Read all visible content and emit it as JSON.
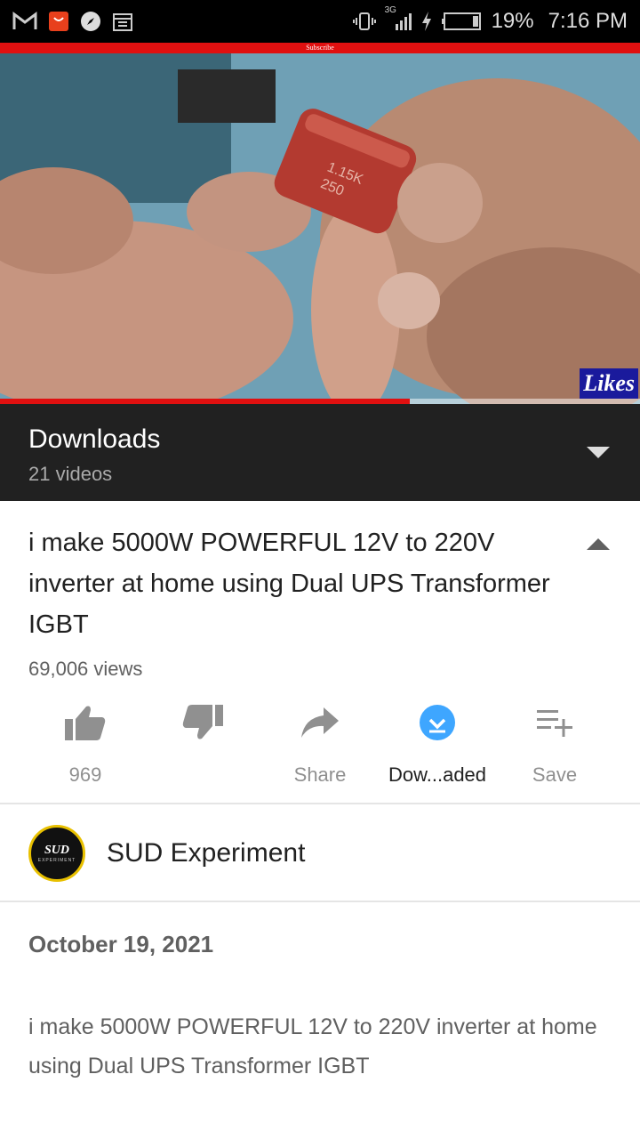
{
  "status_bar": {
    "network": "3G",
    "battery_percent": "19%",
    "time": "7:16 PM",
    "left_icons": [
      "gmail-icon",
      "aliexpress-icon",
      "compass-icon",
      "calendar-icon"
    ]
  },
  "video": {
    "overlay_banner": "Subscribe",
    "likes_badge": "Likes",
    "progress_fraction": 0.64
  },
  "playlist": {
    "title": "Downloads",
    "count": "21 videos"
  },
  "video_info": {
    "title": "i make 5000W POWERFUL 12V to 220V inverter at home using Dual UPS Transformer IGBT",
    "views": "69,006 views"
  },
  "actions": {
    "like_count": "969",
    "dislike_label": "",
    "share_label": "Share",
    "download_label": "Dow...aded",
    "save_label": "Save"
  },
  "channel": {
    "name": "SUD Experiment",
    "avatar_text": "SUD",
    "avatar_subtext": "EXPERIMENT"
  },
  "description": {
    "date": "October 19, 2021",
    "text": "i make 5000W POWERFUL 12V to 220V inverter at home using Dual UPS Transformer IGBT"
  },
  "colors": {
    "accent_red": "#e01010",
    "download_blue": "#3ea6ff",
    "playlist_bg": "#212121"
  }
}
